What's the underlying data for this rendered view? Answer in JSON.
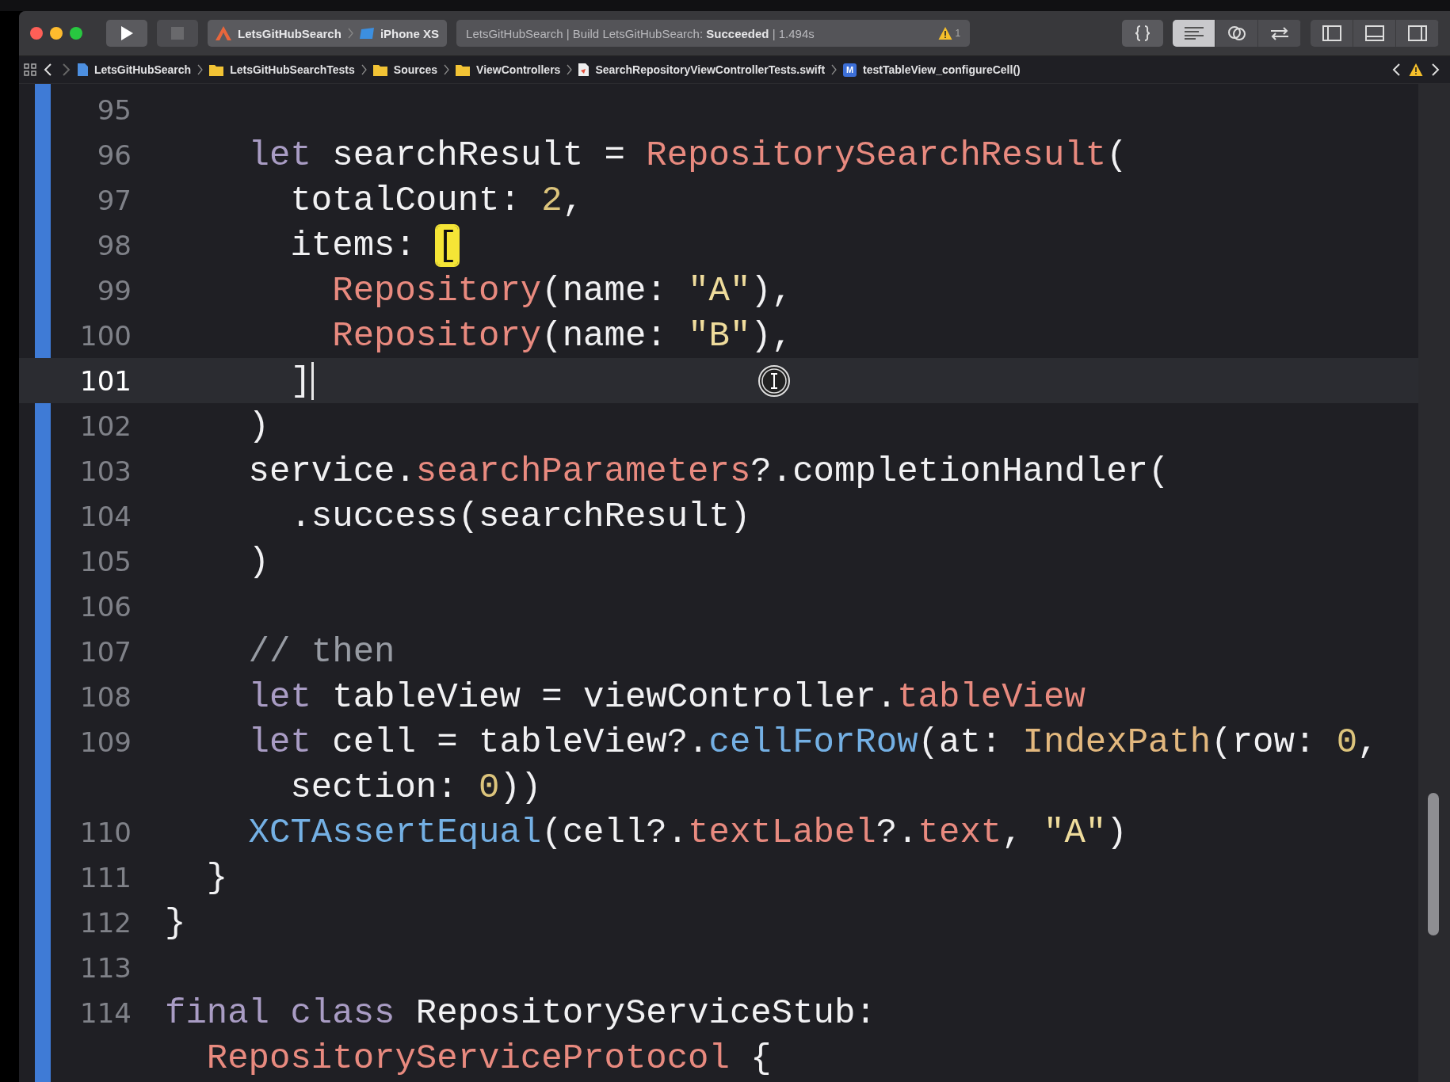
{
  "toolbar": {
    "run_button": {
      "disabled": false
    },
    "stop_button": {
      "disabled": true
    },
    "scheme": {
      "project": "LetsGitHubSearch",
      "device": "iPhone XS"
    },
    "activity": {
      "text": "LetsGitHubSearch | Build LetsGitHubSearch: **Succeeded** | 1.494s",
      "warning_count": "1"
    },
    "editor_modes": [
      {
        "kind": "standard",
        "selected": true
      },
      {
        "kind": "assistant",
        "selected": false
      },
      {
        "kind": "version",
        "selected": false
      }
    ],
    "panels": [
      {
        "kind": "navigator",
        "selected": false
      },
      {
        "kind": "debug",
        "selected": false
      },
      {
        "kind": "inspector",
        "selected": false
      }
    ]
  },
  "breadcrumb": [
    {
      "label": "LetsGitHubSearch",
      "kind": "project"
    },
    {
      "label": "LetsGitHubSearchTests",
      "kind": "folder"
    },
    {
      "label": "Sources",
      "kind": "folder"
    },
    {
      "label": "ViewControllers",
      "kind": "folder"
    },
    {
      "label": "SearchRepositoryViewControllerTests.swift",
      "kind": "file"
    },
    {
      "label": "testTableView_configureCell()",
      "kind": "method",
      "badge": "M"
    }
  ],
  "code": [
    {
      "number": "95",
      "current": false
    },
    {
      "number": "96",
      "current": false,
      "tokens": [
        {
          "t": "    let",
          "kind": "keyword"
        },
        {
          "t": " searchResult = ",
          "kind": "plain"
        },
        {
          "t": "RepositorySearchResult",
          "kind": "type"
        },
        {
          "t": "(",
          "kind": "plain"
        }
      ]
    },
    {
      "number": "97",
      "current": false,
      "tokens": [
        {
          "t": "      totalCount: ",
          "kind": "plain"
        },
        {
          "t": "2",
          "kind": "number"
        },
        {
          "t": ",",
          "kind": "plain"
        }
      ]
    },
    {
      "number": "98",
      "current": false,
      "tokens": [
        {
          "t": "      items: ",
          "kind": "plain"
        },
        {
          "t": "[",
          "kind": "plain",
          "highlighted": true
        }
      ]
    },
    {
      "number": "99",
      "current": false,
      "tokens": [
        {
          "t": "        Repository",
          "kind": "type"
        },
        {
          "t": "(name: ",
          "kind": "plain"
        },
        {
          "t": "\"A\"",
          "kind": "string"
        },
        {
          "t": "),",
          "kind": "plain"
        }
      ]
    },
    {
      "number": "100",
      "current": false,
      "tokens": [
        {
          "t": "        Repository",
          "kind": "type"
        },
        {
          "t": "(name: ",
          "kind": "plain"
        },
        {
          "t": "\"B\"",
          "kind": "string"
        },
        {
          "t": "),",
          "kind": "plain"
        }
      ]
    },
    {
      "number": "101",
      "current": true,
      "cursor": true,
      "tokens": [
        {
          "t": "      ]",
          "kind": "plain"
        }
      ]
    },
    {
      "number": "102",
      "current": false,
      "tokens": [
        {
          "t": "    )",
          "kind": "plain"
        }
      ]
    },
    {
      "number": "103",
      "current": false,
      "tokens": [
        {
          "t": "    service.",
          "kind": "plain"
        },
        {
          "t": "searchParameters",
          "kind": "property"
        },
        {
          "t": "?.completionHandler(",
          "kind": "plain"
        }
      ]
    },
    {
      "number": "104",
      "current": false,
      "tokens": [
        {
          "t": "      .success(searchResult)",
          "kind": "plain"
        }
      ]
    },
    {
      "number": "105",
      "current": false,
      "tokens": [
        {
          "t": "    )",
          "kind": "plain"
        }
      ]
    },
    {
      "number": "106",
      "current": false
    },
    {
      "number": "107",
      "current": false,
      "tokens": [
        {
          "t": "    // then",
          "kind": "comment"
        }
      ]
    },
    {
      "number": "108",
      "current": false,
      "tokens": [
        {
          "t": "    let",
          "kind": "keyword"
        },
        {
          "t": " tableView = viewController.",
          "kind": "plain"
        },
        {
          "t": "tableView",
          "kind": "property"
        }
      ]
    },
    {
      "number": "109",
      "current": false,
      "tokens": [
        {
          "t": "    let",
          "kind": "keyword"
        },
        {
          "t": " cell = tableView?.",
          "kind": "plain"
        },
        {
          "t": "cellForRow",
          "kind": "method"
        },
        {
          "t": "(at: ",
          "kind": "plain"
        },
        {
          "t": "IndexPath",
          "kind": "systype"
        },
        {
          "t": "(row: ",
          "kind": "plain"
        },
        {
          "t": "0",
          "kind": "number"
        },
        {
          "t": ",",
          "kind": "plain"
        }
      ]
    },
    {
      "current": false,
      "tokens": [
        {
          "t": "      section: ",
          "kind": "plain"
        },
        {
          "t": "0",
          "kind": "number"
        },
        {
          "t": "))",
          "kind": "plain"
        }
      ]
    },
    {
      "number": "110",
      "current": false,
      "tokens": [
        {
          "t": "    XCTAssertEqual",
          "kind": "method"
        },
        {
          "t": "(cell?.",
          "kind": "plain"
        },
        {
          "t": "textLabel",
          "kind": "property"
        },
        {
          "t": "?.",
          "kind": "plain"
        },
        {
          "t": "text",
          "kind": "property"
        },
        {
          "t": ", ",
          "kind": "plain"
        },
        {
          "t": "\"A\"",
          "kind": "string"
        },
        {
          "t": ")",
          "kind": "plain"
        }
      ]
    },
    {
      "number": "111",
      "current": false,
      "tokens": [
        {
          "t": "  }",
          "kind": "plain"
        }
      ]
    },
    {
      "number": "112",
      "current": false,
      "tokens": [
        {
          "t": "}",
          "kind": "plain"
        }
      ]
    },
    {
      "number": "113",
      "current": false
    },
    {
      "number": "114",
      "current": false,
      "tokens": [
        {
          "t": "final class",
          "kind": "keyword"
        },
        {
          "t": " RepositoryServiceStub:",
          "kind": "plain"
        }
      ]
    },
    {
      "current": false,
      "tokens": [
        {
          "t": "  RepositoryServiceProtocol",
          "kind": "type"
        },
        {
          "t": " {",
          "kind": "plain"
        }
      ]
    }
  ]
}
